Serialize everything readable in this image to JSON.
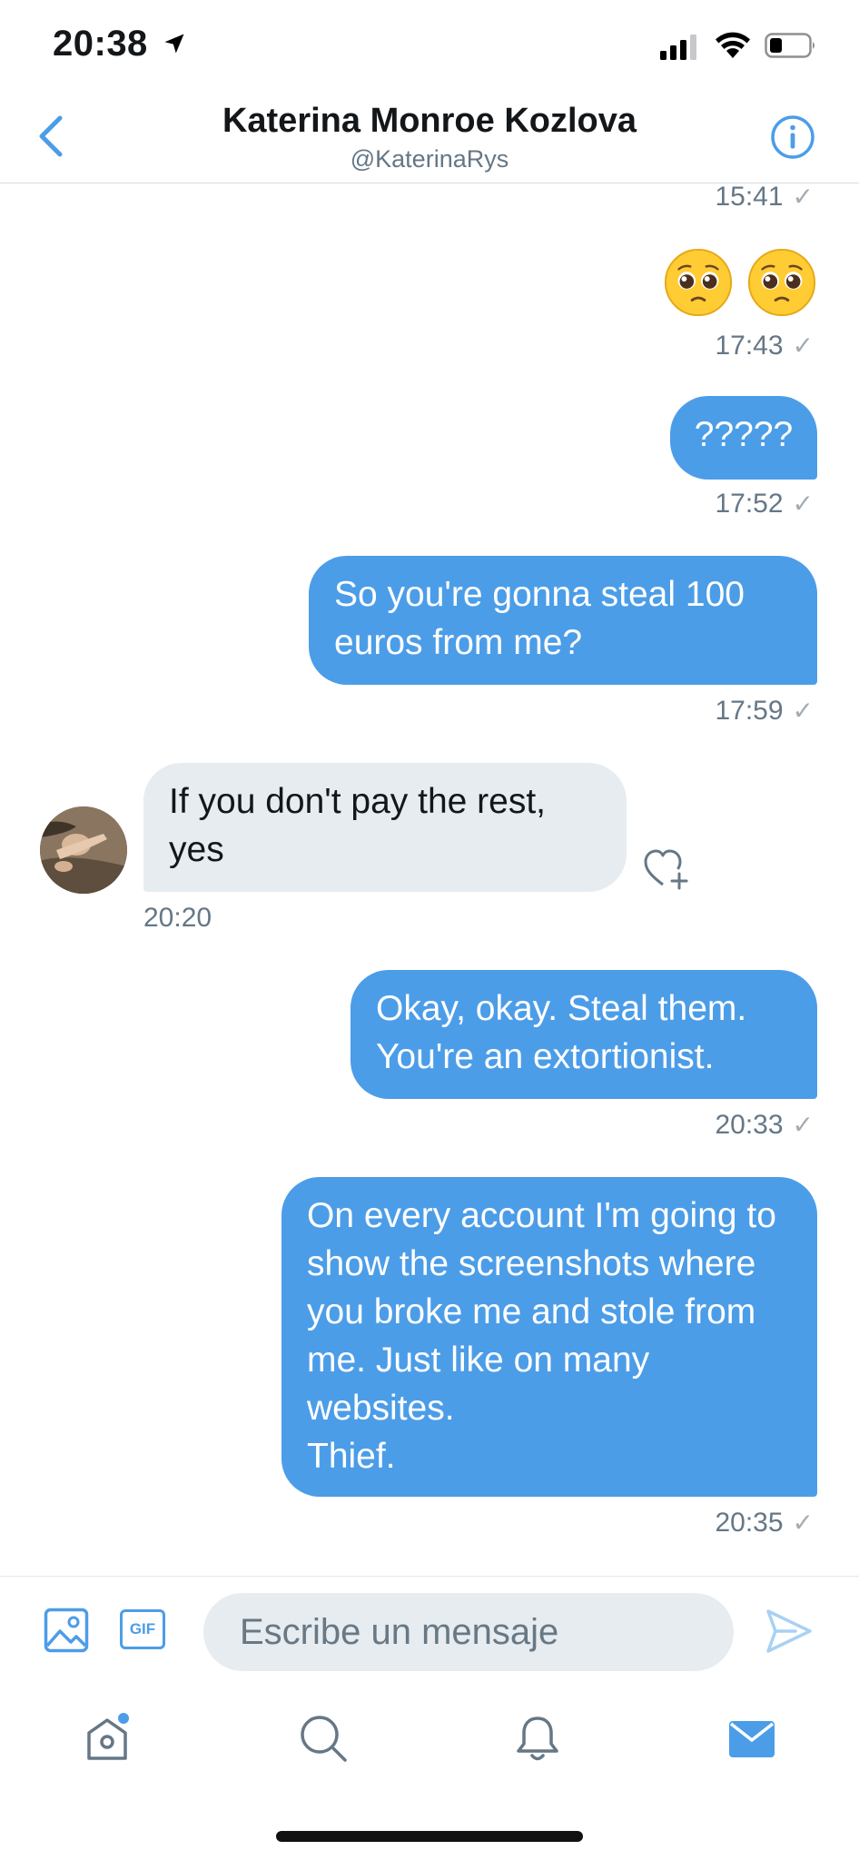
{
  "status_bar": {
    "time": "20:38"
  },
  "header": {
    "title": "Katerina Monroe Kozlova",
    "handle": "@KaterinaRys"
  },
  "messages": [
    {
      "direction": "outgoing",
      "text": "",
      "time": "15:41",
      "status": "✓"
    },
    {
      "direction": "outgoing",
      "text": "",
      "emojis": [
        "pleading-face",
        "pleading-face"
      ],
      "time": "17:43",
      "status": "✓"
    },
    {
      "direction": "outgoing",
      "text": "?????",
      "time": "17:52",
      "status": "✓"
    },
    {
      "direction": "outgoing",
      "text": "So you're gonna steal 100 euros from me?",
      "time": "17:59",
      "status": "✓"
    },
    {
      "direction": "incoming",
      "text": "If you don't pay the rest, yes",
      "time": "20:20"
    },
    {
      "direction": "outgoing",
      "text": "Okay, okay. Steal them. You're an extortionist.",
      "time": "20:33",
      "status": "✓"
    },
    {
      "direction": "outgoing",
      "text": "On every account I'm going to show the screenshots where you broke me and stole from me. Just like on many websites.\nThief.",
      "time": "20:35",
      "status": "✓"
    }
  ],
  "composer": {
    "gif_label": "GIF",
    "placeholder": "Escribe un mensaje"
  },
  "colors": {
    "accent": "#4c9de8",
    "incoming_bubble": "#e6ecf0",
    "secondary_text": "#657786"
  },
  "tab_bar": [
    "home-icon",
    "search-icon",
    "bell-icon",
    "mail-icon"
  ]
}
